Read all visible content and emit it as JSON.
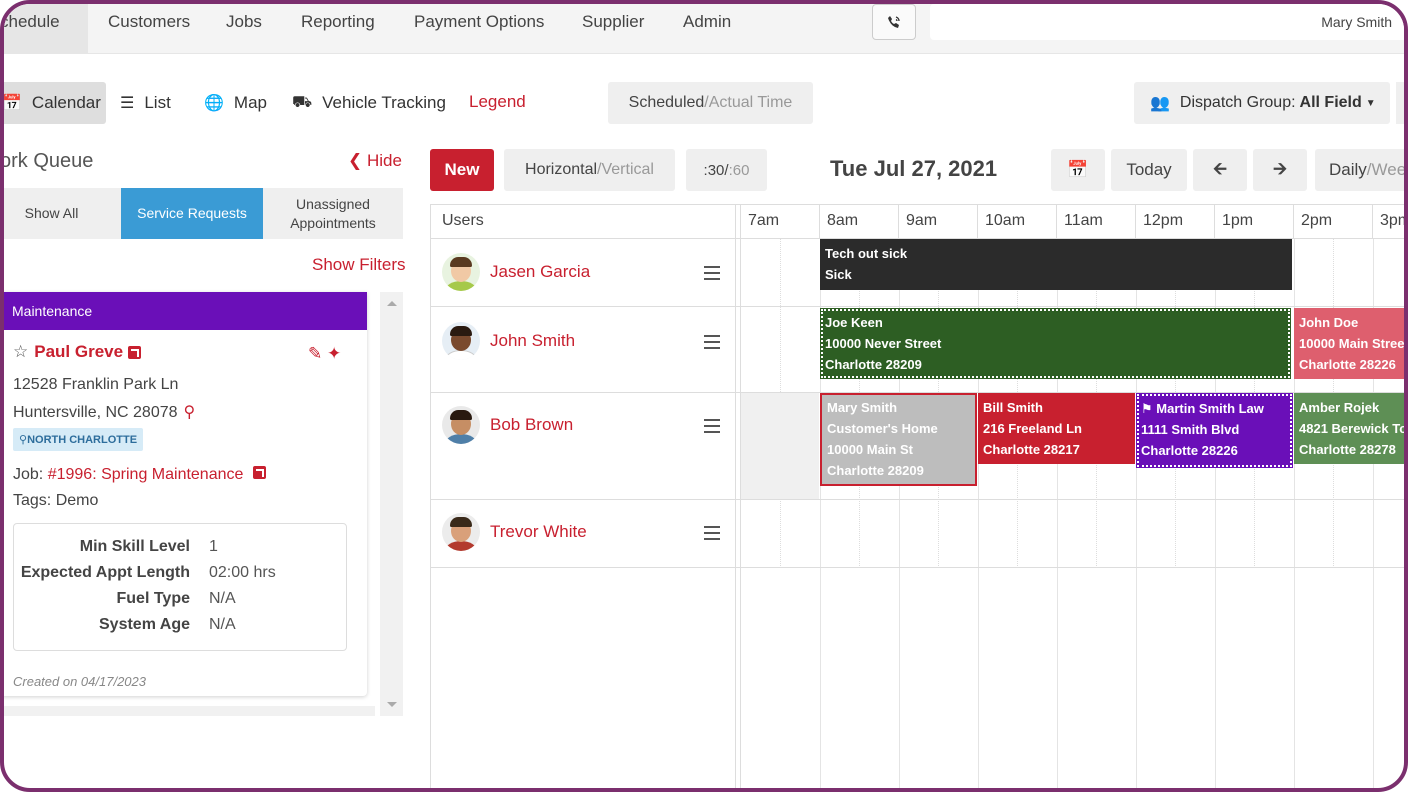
{
  "nav": {
    "tabs": [
      "chedule",
      "Customers",
      "Jobs",
      "Reporting",
      "Payment Options",
      "Supplier",
      "Admin"
    ],
    "user": "Mary Smith"
  },
  "viewbar": {
    "calendar": "Calendar",
    "list": "List",
    "map": "Map",
    "vehicle": "Vehicle Tracking",
    "legend": "Legend",
    "scheduled": "Scheduled",
    "actual": "/Actual Time",
    "dispatch_label": "Dispatch Group:",
    "dispatch_value": "All Field"
  },
  "workqueue": {
    "title": "ork Queue",
    "hide": "Hide",
    "tabs": [
      "Show All",
      "Service Requests",
      "Unassigned\nAppointments"
    ],
    "show_filters": "Show Filters",
    "card": {
      "category": "Maintenance",
      "customer": "Paul Greve",
      "addr1": "12528 Franklin Park Ln",
      "addr2": "Huntersville, NC 28078",
      "zone": "NORTH CHARLOTTE",
      "job_label": "Job:",
      "job_link": "#1996: Spring Maintenance",
      "tags": "Tags: Demo",
      "details": [
        {
          "k": "Min Skill Level",
          "v": "1"
        },
        {
          "k": "Expected Appt Length",
          "v": "02:00 hrs"
        },
        {
          "k": "Fuel Type",
          "v": "N/A"
        },
        {
          "k": "System Age",
          "v": "N/A"
        }
      ],
      "created": "Created on 04/17/2023"
    }
  },
  "toolbar": {
    "new": "New",
    "horizontal": "Horizontal",
    "vertical": "/Vertical",
    "slot_a": ":30/",
    "slot_b": ":60",
    "date": "Tue Jul 27, 2021",
    "today": "Today",
    "daily": "Daily",
    "weekly": "/Wee"
  },
  "grid": {
    "users_header": "Users",
    "hours": [
      "7am",
      "8am",
      "9am",
      "10am",
      "11am",
      "12pm",
      "1pm",
      "2pm",
      "3pm"
    ],
    "users": [
      "Jasen Garcia",
      "John Smith",
      "Bob Brown",
      "Trevor White"
    ],
    "appointments": [
      {
        "lines": [
          "Tech out sick",
          "Sick"
        ],
        "color": "#2b2b2b"
      },
      {
        "lines": [
          "Joe Keen",
          "10000 Never Street",
          "Charlotte 28209"
        ],
        "color": "#2d5e23"
      },
      {
        "lines": [
          "John Doe",
          "10000 Main Stree",
          "Charlotte 28226"
        ],
        "color": "#de5f6e"
      },
      {
        "lines": [
          "Mary Smith",
          "Customer's Home",
          "10000 Main St",
          "Charlotte 28209"
        ],
        "color": "#bdbdbd"
      },
      {
        "lines": [
          "Bill Smith",
          "216 Freeland Ln",
          "Charlotte 28217"
        ],
        "color": "#c8202f"
      },
      {
        "lines": [
          "Martin Smith Law",
          "1111 Smith Blvd",
          "Charlotte 28226"
        ],
        "color": "#6a0fb8"
      },
      {
        "lines": [
          "Amber Rojek",
          "4821 Berewick To",
          "Charlotte 28278"
        ],
        "color": "#5e8f55"
      }
    ]
  },
  "colors": {
    "accent": "#c8202f",
    "info": "#3a9bd5",
    "purple": "#6a0fb8"
  }
}
